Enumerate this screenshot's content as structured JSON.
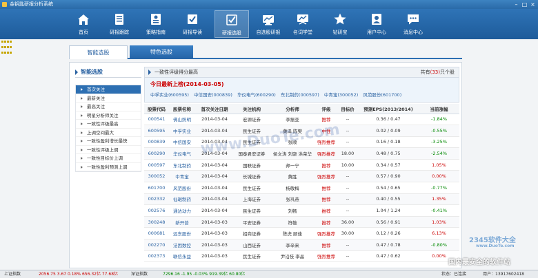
{
  "window": {
    "title": "金钥匙研报分析系统"
  },
  "toolbar": [
    {
      "label": "首页",
      "icon": "home-icon"
    },
    {
      "label": "研报跟踪",
      "icon": "report-icon"
    },
    {
      "label": "策略指南",
      "icon": "strategy-icon"
    },
    {
      "label": "研报导读",
      "icon": "guide-icon"
    },
    {
      "label": "研报选股",
      "icon": "stock-pick-icon"
    },
    {
      "label": "自选股研报",
      "icon": "watchlist-icon"
    },
    {
      "label": "名词学堂",
      "icon": "classroom-icon"
    },
    {
      "label": "钻研宝",
      "icon": "star-icon"
    },
    {
      "label": "用户中心",
      "icon": "user-icon"
    },
    {
      "label": "消息中心",
      "icon": "message-icon"
    }
  ],
  "tabs": {
    "smart": "智能选股",
    "feature": "特色选股"
  },
  "leftnav": {
    "title": "智能选股",
    "items": [
      "首次关注",
      "最新关注",
      "最高关注",
      "明星分析师关注",
      "一致性评级最高",
      "上调空间最大",
      "一致性盈利增长最快",
      "一致性评级上调",
      "一致性目标价上调",
      "一致性盈利预测上调"
    ]
  },
  "main": {
    "heading": "一致性评级得分最高",
    "count_prefix": "共有",
    "count": "(33)",
    "count_suffix": "只个股",
    "news_title": "今日最新上榜(2014-03-05)",
    "news_stocks": [
      "中孚实业(600595)",
      "中信国安(000839)",
      "华仪电气(600290)",
      "东北制药(000597)",
      "中青宝(300052)",
      "风范股份(601700)"
    ]
  },
  "table": {
    "headers": [
      "股票代码",
      "股票名称",
      "首次关注日期",
      "关注机构",
      "分析师",
      "评级",
      "目标价",
      "预测EPS(2013/2014)",
      "当前涨幅"
    ],
    "rows": [
      {
        "code": "000541",
        "name": "佛山照明",
        "date": "2014-03-04",
        "org": "宏源证券",
        "analyst": "李振亚",
        "rating": "推荐",
        "target": "--",
        "eps": "0.36 / 0.47",
        "change": "-1.84%",
        "dir": "down"
      },
      {
        "code": "600595",
        "name": "中孚实业",
        "date": "2014-03-04",
        "org": "民生证券",
        "analyst": "黄泽 陈樊",
        "rating": "中性",
        "target": "--",
        "eps": "0.02 / 0.09",
        "change": "-0.55%",
        "dir": "down"
      },
      {
        "code": "000839",
        "name": "中信国安",
        "date": "2014-03-04",
        "org": "民生证券",
        "analyst": "张顺",
        "rating": "强烈推荐",
        "target": "--",
        "eps": "0.16 / 0.18",
        "change": "-3.25%",
        "dir": "down"
      },
      {
        "code": "600290",
        "name": "华仪电气",
        "date": "2014-03-04",
        "org": "国泰君安证券",
        "analyst": "侯文涛 刘骁 洪荣华",
        "rating": "强烈推荐",
        "target": "18.00",
        "eps": "0.48 / 0.75",
        "change": "-2.54%",
        "dir": "down"
      },
      {
        "code": "000597",
        "name": "东北制药",
        "date": "2014-03-04",
        "org": "国联证券",
        "analyst": "邦一宁",
        "rating": "推荐",
        "target": "10.00",
        "eps": "0.34 / 0.57",
        "change": "1.05%",
        "dir": "up"
      },
      {
        "code": "300052",
        "name": "中青宝",
        "date": "2014-03-04",
        "org": "长城证券",
        "analyst": "黄胜",
        "rating": "强烈推荐",
        "target": "--",
        "eps": "0.57 / 0.90",
        "change": "0.00%",
        "dir": "up"
      },
      {
        "code": "601700",
        "name": "风范股份",
        "date": "2014-03-04",
        "org": "民生证券",
        "analyst": "杨敬梅",
        "rating": "推荐",
        "target": "--",
        "eps": "0.54 / 0.65",
        "change": "-0.77%",
        "dir": "down"
      },
      {
        "code": "002332",
        "name": "仙琚制药",
        "date": "2014-03-04",
        "org": "上海证券",
        "analyst": "张巩燕",
        "rating": "推荐",
        "target": "--",
        "eps": "0.40 / 0.55",
        "change": "1.35%",
        "dir": "up"
      },
      {
        "code": "002576",
        "name": "通达动力",
        "date": "2014-03-04",
        "org": "民生证券",
        "analyst": "刘畅",
        "rating": "推荐",
        "target": "--",
        "eps": "1.04 / 1.24",
        "change": "-0.41%",
        "dir": "down"
      },
      {
        "code": "300248",
        "name": "新开普",
        "date": "2014-03-03",
        "org": "平安证券",
        "analyst": "符雄",
        "rating": "推荐",
        "target": "36.00",
        "eps": "0.56 / 0.91",
        "change": "1.03%",
        "dir": "up"
      },
      {
        "code": "000681",
        "name": "远东股份",
        "date": "2014-03-03",
        "org": "招商证券",
        "analyst": "陈虎 顾佳",
        "rating": "强烈推荐",
        "target": "30.00",
        "eps": "0.12 / 0.26",
        "change": "6.13%",
        "dir": "up"
      },
      {
        "code": "002270",
        "name": "法因数控",
        "date": "2014-03-03",
        "org": "山西证券",
        "analyst": "李辛来",
        "rating": "推荐",
        "target": "--",
        "eps": "0.47 / 0.78",
        "change": "-0.80%",
        "dir": "down"
      },
      {
        "code": "002373",
        "name": "联信永益",
        "date": "2014-03-03",
        "org": "民生证券",
        "analyst": "尹沿技 李晶",
        "rating": "强烈推荐",
        "target": "--",
        "eps": "0.47 / 0.62",
        "change": "0.00%",
        "dir": "up"
      }
    ]
  },
  "statusbar": {
    "sh_label": "上证指数",
    "sh_values": "2056.75  3.67  0.18%  656.32亿  77.68亿",
    "sz_label": "深证指数",
    "sz_values": "7296.16  -1.95  -0.03%  919.39亿  60.80亿",
    "status": "状态：已连接",
    "user": "用户：13917602418"
  },
  "watermarks": {
    "center": "www.DuoTe.com",
    "brand": "2345软件大全",
    "brand_url": "www.DuoTe.com",
    "tagline": "国内最安全的软件站"
  },
  "colors": {
    "accent": "#2d6fb2",
    "up": "#cc0000",
    "down": "#008800"
  }
}
